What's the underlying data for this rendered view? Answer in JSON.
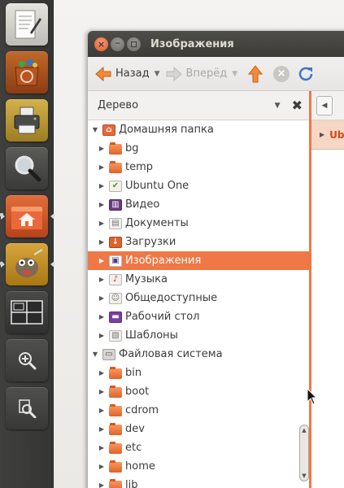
{
  "window": {
    "title": "Изображения"
  },
  "launcher": {
    "items": [
      {
        "name": "text-editor",
        "icon": "text-editor-icon"
      },
      {
        "name": "software-center",
        "icon": "software-center-icon"
      },
      {
        "name": "printer",
        "icon": "printer-icon"
      },
      {
        "name": "search",
        "icon": "magnifier-icon"
      },
      {
        "name": "home-folder",
        "icon": "home-folder-icon",
        "active": true
      },
      {
        "name": "gimp",
        "icon": "gimp-icon",
        "active": true
      },
      {
        "name": "workspaces",
        "icon": "workspace-switcher-icon"
      },
      {
        "name": "zoom-in",
        "icon": "zoom-in-icon"
      },
      {
        "name": "zoom-fit",
        "icon": "zoom-fit-icon"
      }
    ]
  },
  "toolbar": {
    "back_label": "Назад",
    "forward_label": "Вперёд"
  },
  "sidepane": {
    "header": "Дерево"
  },
  "tree": {
    "rows": [
      {
        "label": "Домашняя папка",
        "level": 0,
        "expanded": true,
        "icon": "home-icon"
      },
      {
        "label": "bg",
        "level": 1,
        "icon": "folder-icon"
      },
      {
        "label": "temp",
        "level": 1,
        "icon": "folder-icon"
      },
      {
        "label": "Ubuntu One",
        "level": 1,
        "icon": "ubuntu-one-icon"
      },
      {
        "label": "Видео",
        "level": 1,
        "icon": "video-folder-icon"
      },
      {
        "label": "Документы",
        "level": 1,
        "icon": "documents-folder-icon"
      },
      {
        "label": "Загрузки",
        "level": 1,
        "icon": "downloads-folder-icon"
      },
      {
        "label": "Изображения",
        "level": 1,
        "icon": "pictures-folder-icon",
        "selected": true
      },
      {
        "label": "Музыка",
        "level": 1,
        "icon": "music-folder-icon"
      },
      {
        "label": "Общедоступные",
        "level": 1,
        "icon": "public-folder-icon"
      },
      {
        "label": "Рабочий стол",
        "level": 1,
        "icon": "desktop-folder-icon"
      },
      {
        "label": "Шаблоны",
        "level": 1,
        "icon": "templates-folder-icon"
      },
      {
        "label": "Файловая система",
        "level": 0,
        "expanded": true,
        "icon": "drive-icon"
      },
      {
        "label": "bin",
        "level": 1,
        "icon": "folder-icon"
      },
      {
        "label": "boot",
        "level": 1,
        "icon": "folder-icon"
      },
      {
        "label": "cdrom",
        "level": 1,
        "icon": "folder-icon"
      },
      {
        "label": "dev",
        "level": 1,
        "icon": "folder-icon"
      },
      {
        "label": "etc",
        "level": 1,
        "icon": "folder-icon"
      },
      {
        "label": "home",
        "level": 1,
        "icon": "folder-icon"
      },
      {
        "label": "lib",
        "level": 1,
        "icon": "folder-icon"
      }
    ]
  },
  "mainpane": {
    "crumb": "Ub"
  },
  "colors": {
    "accent": "#f07746",
    "titlebar": "#3c3b37",
    "launcher": "#3a3a38"
  }
}
